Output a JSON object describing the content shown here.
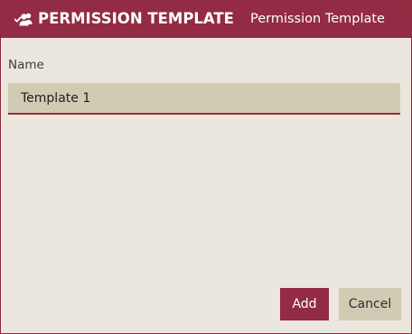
{
  "dialog": {
    "title": "PERMISSION TEMPLATE",
    "subtitle": "Permission Template",
    "icon": "users-check-icon"
  },
  "form": {
    "name_label": "Name",
    "name_value": "Template 1"
  },
  "actions": {
    "add_label": "Add",
    "cancel_label": "Cancel"
  },
  "colors": {
    "accent": "#922b43",
    "background": "#ebe7df",
    "input_bg": "#d1cbb3"
  }
}
